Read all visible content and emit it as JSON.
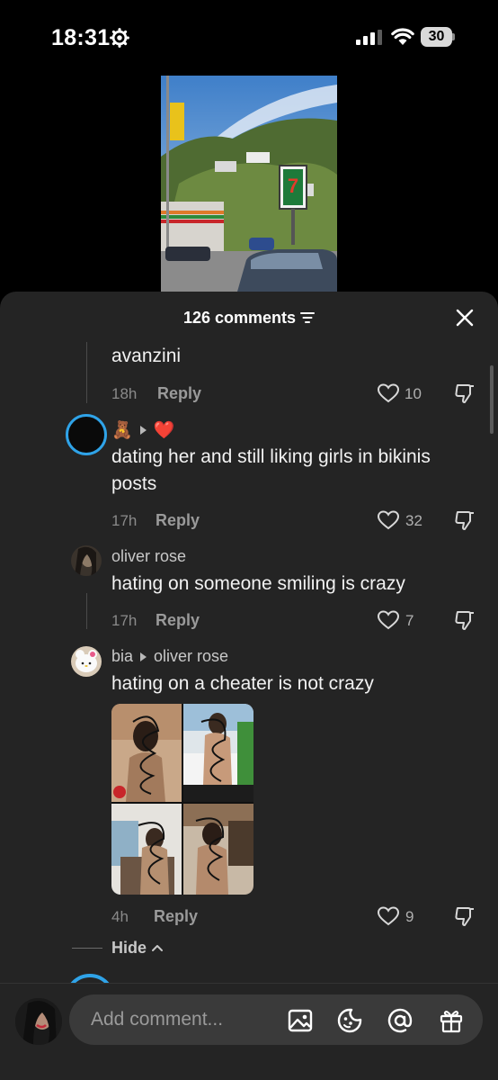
{
  "status_bar": {
    "time": "18:31",
    "battery": "30"
  },
  "sheet": {
    "comments_count": "126 comments"
  },
  "comments": [
    {
      "text": "avanzini",
      "time": "18h",
      "reply_label": "Reply",
      "likes": "10"
    },
    {
      "username_emoji": "🧸",
      "reply_to_emoji": "❤️",
      "text": "dating her and still liking girls in bikinis posts",
      "time": "17h",
      "reply_label": "Reply",
      "likes": "32"
    },
    {
      "username": "oliver rose",
      "text": "hating on someone smiling is crazy",
      "time": "17h",
      "reply_label": "Reply",
      "likes": "7"
    },
    {
      "username": "bia",
      "reply_to": "oliver rose",
      "text": "hating on a cheater is not crazy",
      "time": "4h",
      "reply_label": "Reply",
      "likes": "9"
    }
  ],
  "hide_label": "Hide",
  "input": {
    "placeholder": "Add comment..."
  },
  "icons": {
    "accent_ring": "#2fa3e8"
  }
}
